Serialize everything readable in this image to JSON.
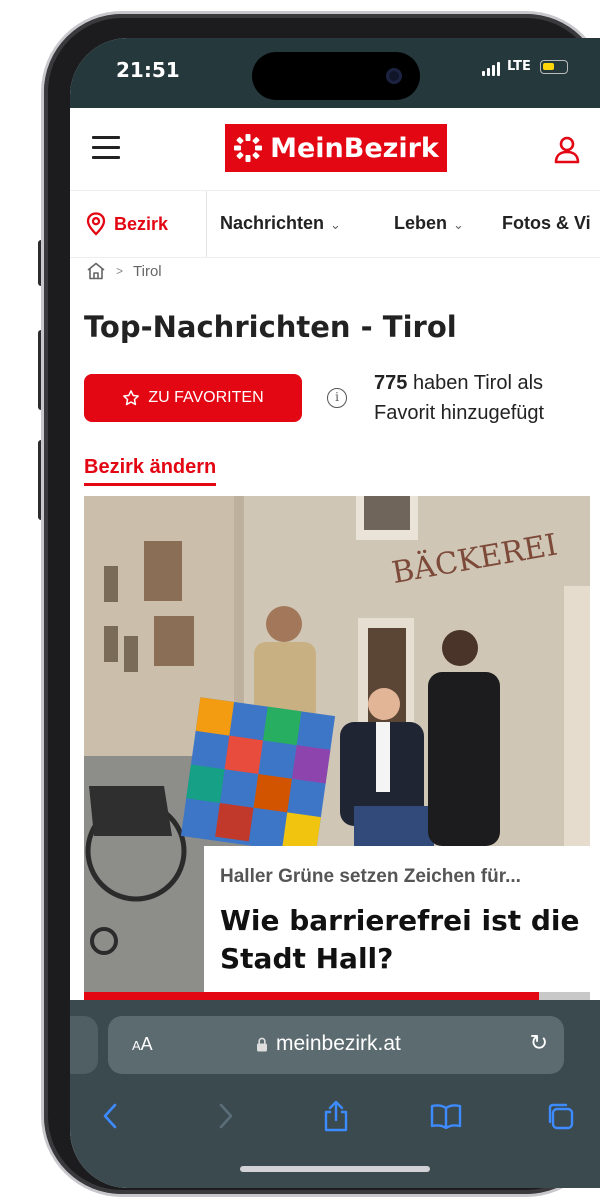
{
  "status_bar": {
    "time": "21:51",
    "network": "LTE",
    "battery_level": 0.5
  },
  "header": {
    "logo_text": "MeinBezirk"
  },
  "nav": {
    "bezirk_label": "Bezirk",
    "items": [
      {
        "label": "Nachrichten"
      },
      {
        "label": "Leben"
      },
      {
        "label": "Fotos & Vi"
      }
    ]
  },
  "breadcrumb": {
    "current": "Tirol"
  },
  "page": {
    "title": "Top-Nachrichten - Tirol",
    "favorite_button": "ZU FAVORITEN",
    "favorite_count": "775",
    "favorite_text": "haben Tirol als Favorit hinzugefügt",
    "change_link": "Bezirk ändern"
  },
  "article": {
    "shop_sign": "BÄCKEREI",
    "kicker": "Haller Grüne setzen Zeichen für...",
    "headline": "Wie barrierefrei ist die Stadt Hall?",
    "slider_progress": 0.9
  },
  "browser": {
    "text_size_label_small": "A",
    "text_size_label_large": "A",
    "url": "meinbezirk.at"
  },
  "colors": {
    "brand_red": "#e30613",
    "status_bar_bg": "#25383b",
    "safari_bg": "#3a4a4f"
  },
  "icons": [
    "menu-icon",
    "user-icon",
    "location-pin-icon",
    "home-icon",
    "star-icon",
    "info-icon",
    "lock-icon",
    "reload-icon",
    "back-icon",
    "forward-icon",
    "share-icon",
    "bookmarks-icon",
    "tabs-icon"
  ]
}
